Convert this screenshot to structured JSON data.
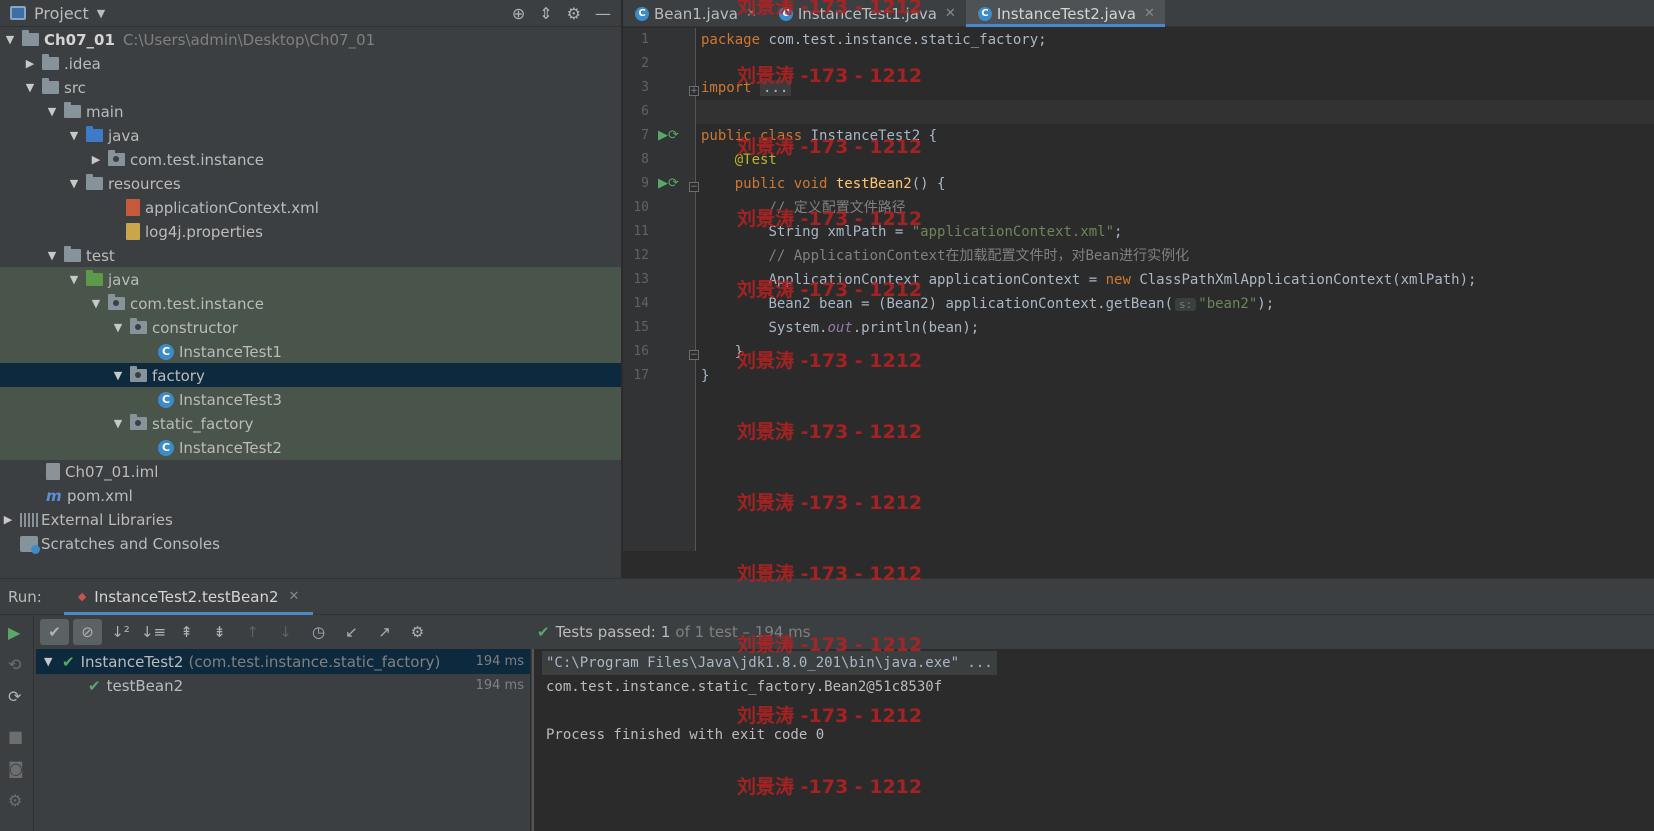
{
  "project_panel": {
    "title": "Project",
    "tree": [
      {
        "label": "Ch07_01",
        "path": "C:\\Users\\admin\\Desktop\\Ch07_01"
      },
      {
        "label": ".idea"
      },
      {
        "label": "src"
      },
      {
        "label": "main"
      },
      {
        "label": "java"
      },
      {
        "label": "com.test.instance"
      },
      {
        "label": "resources"
      },
      {
        "label": "applicationContext.xml"
      },
      {
        "label": "log4j.properties"
      },
      {
        "label": "test"
      },
      {
        "label": "java"
      },
      {
        "label": "com.test.instance"
      },
      {
        "label": "constructor"
      },
      {
        "label": "InstanceTest1"
      },
      {
        "label": "factory"
      },
      {
        "label": "InstanceTest3"
      },
      {
        "label": "static_factory"
      },
      {
        "label": "InstanceTest2"
      },
      {
        "label": "Ch07_01.iml"
      },
      {
        "label": "pom.xml"
      },
      {
        "label": "External Libraries"
      },
      {
        "label": "Scratches and Consoles"
      }
    ]
  },
  "editor": {
    "tabs": [
      {
        "label": "Bean1.java"
      },
      {
        "label": "InstanceTest1.java"
      },
      {
        "label": "InstanceTest2.java"
      }
    ],
    "line_numbers": [
      "1",
      "2",
      "3",
      "6",
      "7",
      "8",
      "9",
      "10",
      "11",
      "12",
      "13",
      "14",
      "15",
      "16",
      "17"
    ],
    "code": {
      "l1_kw": "package",
      "l1_rest": " com.test.instance.static_factory;",
      "l3_kw": "import",
      "l3_fold": "...",
      "l7_kw": "public class",
      "l7_rest": " InstanceTest2 {",
      "l8_ann": "@Test",
      "l9_kw": "public void",
      "l9_fn": "testBean2",
      "l9_rest": "() {",
      "l10_cmt": "// 定义配置文件路径",
      "l11_a": "String xmlPath = ",
      "l11_str": "\"applicationContext.xml\"",
      "l11_b": ";",
      "l12_cmt": "// ApplicationContext在加载配置文件时，对Bean进行实例化",
      "l13_a": "ApplicationContext applicationContext = ",
      "l13_kw": "new",
      "l13_b": " ClassPathXmlApplicationContext(xmlPath);",
      "l14_a": "Bean2 bean = (Bean2) applicationContext.getBean(",
      "l14_hint": "s:",
      "l14_str": "\"bean2\"",
      "l14_b": ");",
      "l15_a": "System.",
      "l15_fld": "out",
      "l15_b": ".println(bean);",
      "l16": "}",
      "l17": "}"
    }
  },
  "run_panel": {
    "label": "Run:",
    "tab_label": "InstanceTest2.testBean2",
    "status_prefix": "Tests passed:",
    "status_count": "1",
    "status_rest": "of 1 test – 194 ms",
    "tests": [
      {
        "name": "InstanceTest2",
        "package": "(com.test.instance.static_factory)",
        "time": "194 ms"
      },
      {
        "name": "testBean2",
        "time": "194 ms"
      }
    ],
    "console": [
      "\"C:\\Program Files\\Java\\jdk1.8.0_201\\bin\\java.exe\" ...",
      "com.test.instance.static_factory.Bean2@51c8530f",
      "Process finished with exit code 0"
    ]
  },
  "watermark": "刘景涛 -173 - 1212",
  "colors": {
    "accent": "#4a88c7",
    "keyword": "#cc7832",
    "string": "#6a8759",
    "pass_green": "#59a869",
    "watermark": "#b22222"
  }
}
